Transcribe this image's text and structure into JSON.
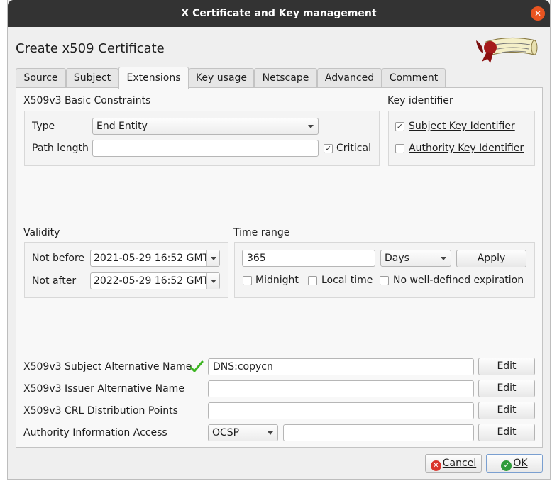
{
  "window": {
    "title": "X Certificate and Key management"
  },
  "header": {
    "title": "Create x509 Certificate"
  },
  "tabs": [
    "Source",
    "Subject",
    "Extensions",
    "Key usage",
    "Netscape",
    "Advanced",
    "Comment"
  ],
  "basic_constraints": {
    "title": "X509v3 Basic Constraints",
    "type_label": "Type",
    "type_value": "End Entity",
    "path_length_label": "Path length",
    "path_length_value": "",
    "critical_label": "Critical",
    "critical_checked": true
  },
  "key_identifier": {
    "title": "Key identifier",
    "subject_label": "Subject Key Identifier",
    "subject_checked": true,
    "authority_label": "Authority Key Identifier",
    "authority_checked": false
  },
  "validity": {
    "title": "Validity",
    "not_before_label": "Not before",
    "not_before_value": "2021-05-29 16:52 GMT",
    "not_after_label": "Not after",
    "not_after_value": "2022-05-29 16:52 GMT"
  },
  "time_range": {
    "title": "Time range",
    "value": "365",
    "unit": "Days",
    "apply_label": "Apply",
    "midnight_label": "Midnight",
    "local_time_label": "Local time",
    "no_expiration_label": "No well-defined expiration"
  },
  "extensions": {
    "san_label": "X509v3 Subject Alternative Name",
    "san_value": "DNS:copycn",
    "ian_label": "X509v3 Issuer Alternative Name",
    "ian_value": "",
    "crl_label": "X509v3 CRL Distribution Points",
    "crl_value": "",
    "aia_label": "Authority Information Access",
    "aia_method": "OCSP",
    "aia_value": "",
    "edit_label": "Edit"
  },
  "footer": {
    "cancel_label": "Cancel",
    "ok_label": "OK"
  },
  "colors": {
    "accent": "#e95420",
    "titlebar": "#333333",
    "valid_check": "#3cb521"
  }
}
